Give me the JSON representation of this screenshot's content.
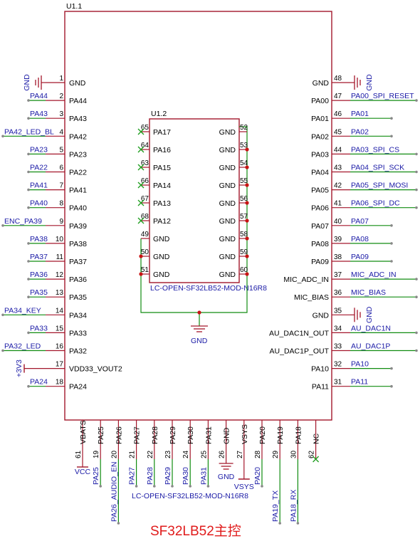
{
  "title": "SF32LB52主控",
  "main_ic": {
    "ref": "U1.1",
    "part": "LC-OPEN-SF32LB52-MOD-N16R8",
    "left_pins": [
      {
        "num": "1",
        "name": "GND",
        "net": ""
      },
      {
        "num": "2",
        "name": "PA44",
        "net": "PA44"
      },
      {
        "num": "3",
        "name": "PA43",
        "net": "PA43"
      },
      {
        "num": "4",
        "name": "PA42",
        "net": "PA42_LED_BL"
      },
      {
        "num": "5",
        "name": "PA23",
        "net": "PA23"
      },
      {
        "num": "6",
        "name": "PA22",
        "net": "PA22"
      },
      {
        "num": "7",
        "name": "PA41",
        "net": "PA41"
      },
      {
        "num": "8",
        "name": "PA40",
        "net": "PA40"
      },
      {
        "num": "9",
        "name": "PA39",
        "net": "ENC_PA39"
      },
      {
        "num": "10",
        "name": "PA38",
        "net": "PA38"
      },
      {
        "num": "11",
        "name": "PA37",
        "net": "PA37"
      },
      {
        "num": "12",
        "name": "PA36",
        "net": "PA36"
      },
      {
        "num": "13",
        "name": "PA35",
        "net": "PA35"
      },
      {
        "num": "14",
        "name": "PA34",
        "net": "PA34_KEY"
      },
      {
        "num": "15",
        "name": "PA33",
        "net": "PA33"
      },
      {
        "num": "16",
        "name": "PA32",
        "net": "PA32_LED"
      },
      {
        "num": "17",
        "name": "VDD33_VOUT2",
        "net": ""
      },
      {
        "num": "18",
        "name": "PA24",
        "net": "PA24"
      }
    ],
    "right_pins": [
      {
        "num": "48",
        "name": "GND",
        "net": ""
      },
      {
        "num": "47",
        "name": "PA00",
        "net": "PA00_SPI_RESET"
      },
      {
        "num": "46",
        "name": "PA01",
        "net": "PA01"
      },
      {
        "num": "45",
        "name": "PA02",
        "net": "PA02"
      },
      {
        "num": "44",
        "name": "PA03",
        "net": "PA03_SPI_CS"
      },
      {
        "num": "43",
        "name": "PA04",
        "net": "PA04_SPI_SCK"
      },
      {
        "num": "42",
        "name": "PA05",
        "net": "PA05_SPI_MOSI"
      },
      {
        "num": "41",
        "name": "PA06",
        "net": "PA06_SPI_DC"
      },
      {
        "num": "40",
        "name": "PA07",
        "net": "PA07"
      },
      {
        "num": "39",
        "name": "PA08",
        "net": "PA08"
      },
      {
        "num": "38",
        "name": "PA09",
        "net": "PA09"
      },
      {
        "num": "37",
        "name": "MIC_ADC_IN",
        "net": "MIC_ADC_IN"
      },
      {
        "num": "36",
        "name": "MIC_BIAS",
        "net": "MIC_BIAS"
      },
      {
        "num": "35",
        "name": "GND",
        "net": ""
      },
      {
        "num": "34",
        "name": "AU_DAC1N_OUT",
        "net": "AU_DAC1N"
      },
      {
        "num": "33",
        "name": "AU_DAC1P_OUT",
        "net": "AU_DAC1P"
      },
      {
        "num": "32",
        "name": "PA10",
        "net": "PA10"
      },
      {
        "num": "31",
        "name": "PA11",
        "net": "PA11"
      }
    ],
    "bottom_pins": [
      {
        "num": "61",
        "name": "VBATS",
        "net": "VCC"
      },
      {
        "num": "19",
        "name": "PA25",
        "net": "PA25"
      },
      {
        "num": "20",
        "name": "PA26",
        "net": "PA26_AUDIO_EN"
      },
      {
        "num": "21",
        "name": "PA27",
        "net": "PA27"
      },
      {
        "num": "22",
        "name": "PA28",
        "net": "PA28"
      },
      {
        "num": "23",
        "name": "PA29",
        "net": "PA29"
      },
      {
        "num": "24",
        "name": "PA30",
        "net": "PA30"
      },
      {
        "num": "25",
        "name": "PA31",
        "net": "PA31"
      },
      {
        "num": "26",
        "name": "GND",
        "net": ""
      },
      {
        "num": "27",
        "name": "VSYS",
        "net": "VSYS"
      },
      {
        "num": "28",
        "name": "PA20",
        "net": "PA20"
      },
      {
        "num": "29",
        "name": "PA19",
        "net": "PA19_TX"
      },
      {
        "num": "30",
        "name": "PA18",
        "net": "PA18_RX"
      },
      {
        "num": "62",
        "name": "NC",
        "net": ""
      }
    ]
  },
  "sub_ic": {
    "ref": "U1.2",
    "part": "LC-OPEN-SF32LB52-MOD-N16R8",
    "left_pins": [
      {
        "num": "65",
        "name": "PA17"
      },
      {
        "num": "64",
        "name": "PA16"
      },
      {
        "num": "63",
        "name": "PA15"
      },
      {
        "num": "66",
        "name": "PA14"
      },
      {
        "num": "67",
        "name": "PA13"
      },
      {
        "num": "68",
        "name": "PA12"
      },
      {
        "num": "49",
        "name": "GND"
      },
      {
        "num": "50",
        "name": "GND"
      },
      {
        "num": "51",
        "name": "GND"
      }
    ],
    "right_pins": [
      {
        "num": "52",
        "name": "GND"
      },
      {
        "num": "53",
        "name": "GND"
      },
      {
        "num": "54",
        "name": "GND"
      },
      {
        "num": "55",
        "name": "GND"
      },
      {
        "num": "56",
        "name": "GND"
      },
      {
        "num": "57",
        "name": "GND"
      },
      {
        "num": "58",
        "name": "GND"
      },
      {
        "num": "59",
        "name": "GND"
      },
      {
        "num": "60",
        "name": "GND"
      }
    ]
  },
  "power": {
    "gnd": "GND",
    "v3v3": "+3V3",
    "vcc": "VCC",
    "vsys": "VSYS"
  },
  "colors": {
    "body": "#a3172b",
    "wire": "#118c11",
    "net": "#1a1aa6",
    "junction": "#c81414",
    "nc": "#1e9e1e",
    "title": "#e01b1b"
  }
}
